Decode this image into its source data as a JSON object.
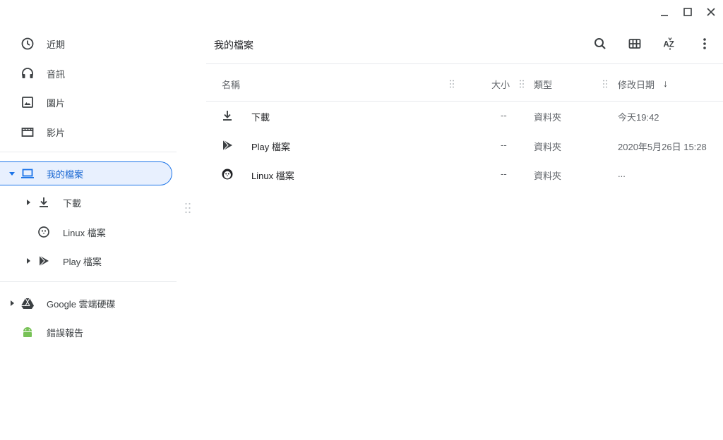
{
  "window": {
    "minimize_icon": "minimize-icon",
    "maximize_icon": "maximize-icon",
    "close_icon": "close-icon"
  },
  "sidebar": {
    "items": [
      {
        "label": "近期",
        "icon": "clock-icon"
      },
      {
        "label": "音訊",
        "icon": "headphones-icon"
      },
      {
        "label": "圖片",
        "icon": "image-icon"
      },
      {
        "label": "影片",
        "icon": "film-icon"
      }
    ],
    "my_files": {
      "label": "我的檔案",
      "icon": "laptop-icon",
      "expanded": true
    },
    "my_files_children": [
      {
        "label": "下載",
        "icon": "download-icon",
        "has_children": true
      },
      {
        "label": "Linux 檔案",
        "icon": "penguin-icon",
        "has_children": false
      },
      {
        "label": "Play 檔案",
        "icon": "play-icon",
        "has_children": true
      }
    ],
    "drive": {
      "label": "Google 雲端硬碟",
      "icon": "drive-icon"
    },
    "feedback": {
      "label": "錯誤報告",
      "icon": "android-icon"
    }
  },
  "main": {
    "title": "我的檔案",
    "toolbar": [
      "search-icon",
      "grid-view-icon",
      "sort-az-icon",
      "more-vert-icon"
    ],
    "columns": {
      "name": "名稱",
      "size": "大小",
      "type": "類型",
      "modified": "修改日期"
    },
    "sort_arrow": "↓",
    "files": [
      {
        "name": "下載",
        "size": "--",
        "type": "資料夾",
        "modified": "今天19:42",
        "icon": "download-icon"
      },
      {
        "name": "Play 檔案",
        "size": "--",
        "type": "資料夾",
        "modified": "2020年5月26日 15:28",
        "icon": "play-icon"
      },
      {
        "name": "Linux 檔案",
        "size": "--",
        "type": "資料夾",
        "modified": "...",
        "icon": "penguin-icon"
      }
    ]
  },
  "colors": {
    "accent": "#1a73e8",
    "selected_bg": "#e8f0fe",
    "icon_gray": "#5f6368",
    "android_green": "#78c257"
  }
}
